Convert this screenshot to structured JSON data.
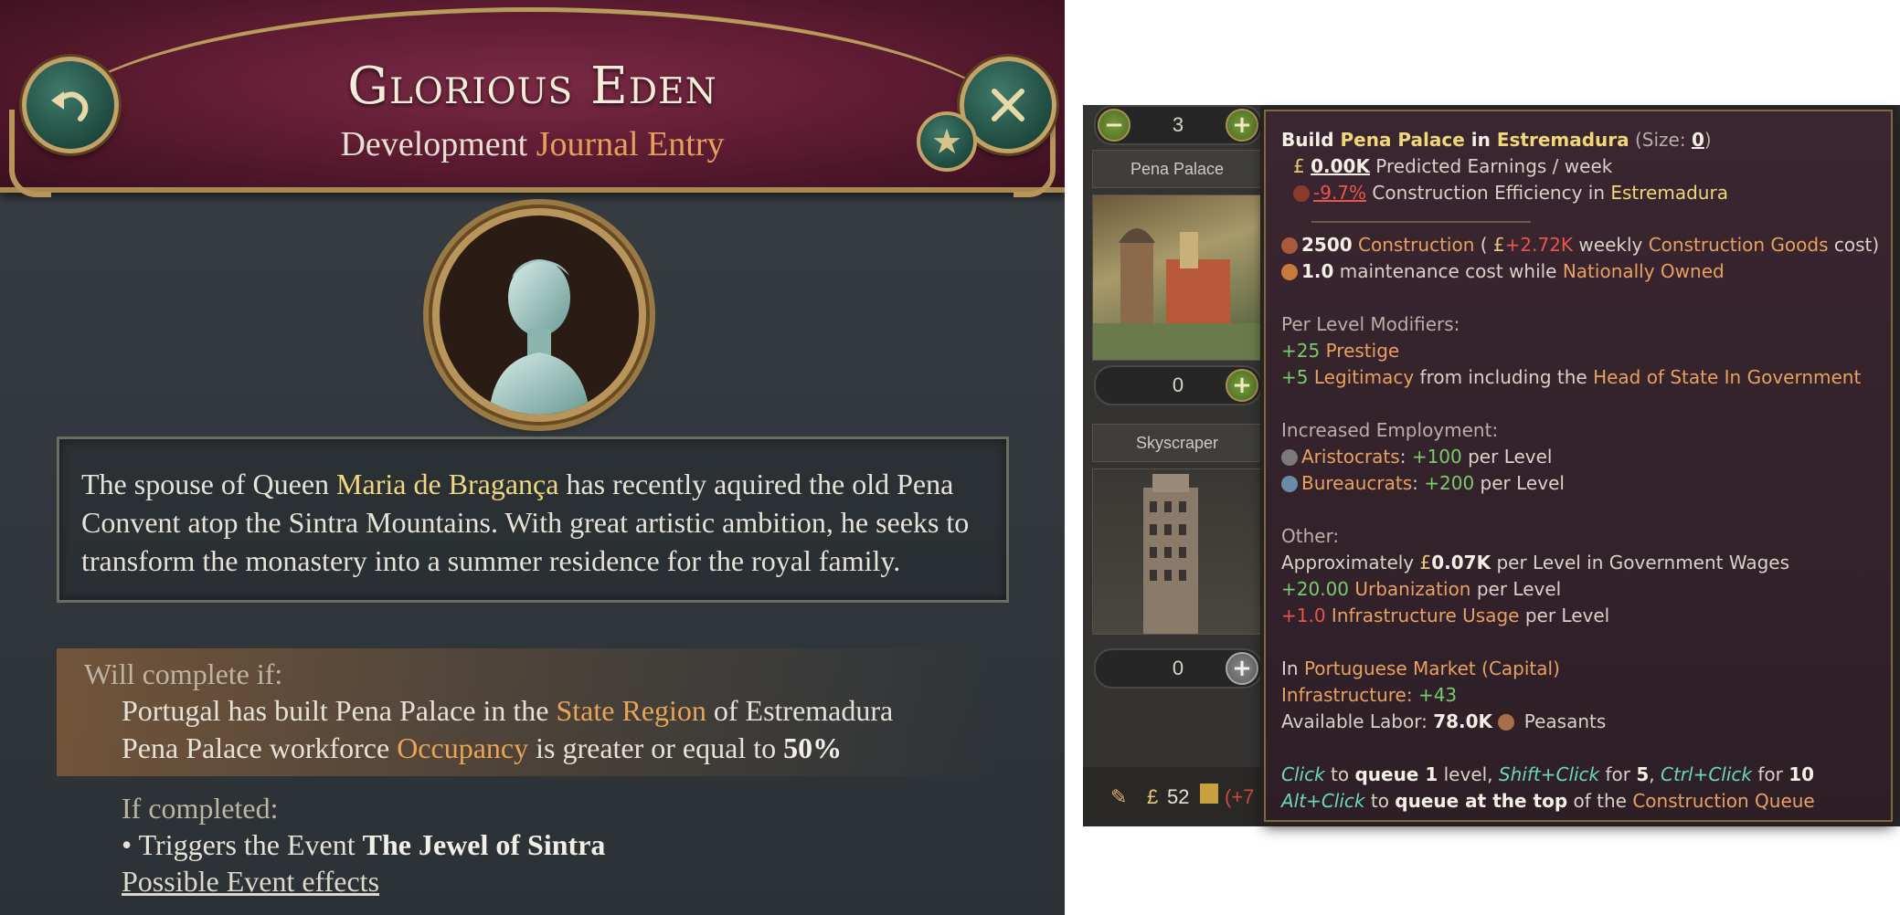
{
  "journal": {
    "title": "Glorious Eden",
    "subtitle_prefix": "Development",
    "subtitle_accent": "Journal Entry",
    "description": {
      "part1": "The spouse of Queen ",
      "name": "Maria de Bragança",
      "part2": " has recently aquired the old Pena",
      "line2": "Convent atop the Sintra Mountains. With great artistic ambition, he seeks to",
      "line3": "transform the monastery into a summer residence for the royal family."
    },
    "complete_if_label": "Will complete if:",
    "condition1": {
      "pre": "Portugal has built Pena Palace in the ",
      "accent": "State Region",
      "post": " of Estremadura"
    },
    "condition2": {
      "pre": "Pena Palace workforce ",
      "accent": "Occupancy",
      "mid": " is greater or equal to ",
      "value": "50%"
    },
    "if_completed_label": "If completed:",
    "trigger": {
      "pre": "• Triggers the Event ",
      "event": "The Jewel of Sintra"
    },
    "effects_link": "Possible Event effects",
    "icons": {
      "back": "back-arrow-icon",
      "close": "close-icon",
      "favorite": "star-icon",
      "portrait": "bust-statue-icon"
    }
  },
  "construction": {
    "stepper1_value": "3",
    "building1": "Pena Palace",
    "stepper2_value": "0",
    "building2": "Skyscraper",
    "stepper3_value": "0",
    "bottom_money": "52",
    "bottom_change": "(+7"
  },
  "tooltip": {
    "title_pre": "Build ",
    "title_building": "Pena Palace",
    "title_mid": " in ",
    "title_region": "Estremadura",
    "title_size_label": " (Size: ",
    "title_size": "0",
    "title_size_end": ")",
    "earnings_value": "0.00K",
    "earnings_label": " Predicted Earnings / week",
    "efficiency_value": "-9.7%",
    "efficiency_label": " Construction Efficiency in ",
    "efficiency_region": "Estremadura",
    "construction_value": "2500",
    "construction_label": " Construction",
    "construction_paren_open": " ( ",
    "construction_cost": "+2.72K",
    "construction_weekly": " weekly ",
    "construction_goods": "Construction Goods",
    "construction_cost_end": " cost)",
    "maintenance_value": "1.0",
    "maintenance_label": " maintenance cost while ",
    "maintenance_status": "Nationally Owned",
    "per_level_label": "Per Level Modifiers:",
    "prestige_value": "+25",
    "prestige_label": " Prestige",
    "legit_value": "+5",
    "legit_label": " Legitimacy",
    "legit_mid": " from including the ",
    "legit_source": "Head of State In Government",
    "employment_label": "Increased Employment:",
    "aristocrats_label": "Aristocrats",
    "aristocrats_value": "+100",
    "bureaucrats_label": "Bureaucrats",
    "bureaucrats_value": "+200",
    "per_level": " per Level",
    "other_label": "Other:",
    "wages_pre": "Approximately ",
    "wages_value": "0.07K",
    "wages_post": " per Level in Government Wages",
    "urban_value": "+20.00",
    "urban_label": " Urbanization",
    "infra_value": "+1.0",
    "infra_label": " Infrastructure Usage",
    "market_pre": "In ",
    "market_name": "Portuguese Market",
    "market_capital": "(Capital)",
    "infrastructure_label": "Infrastructure: ",
    "infrastructure_value": "+43",
    "labor_label": "Available Labor: ",
    "labor_value": "78.0K",
    "labor_type": " Peasants",
    "click": "Click",
    "to": " to ",
    "queue1": "queue 1",
    "level_comma": " level, ",
    "shift_click": "Shift+Click",
    "for": " for ",
    "five": "5",
    "comma": ", ",
    "ctrl_click": "Ctrl+Click",
    "ten": "10",
    "alt_click": "Alt+Click",
    "queue_top": "queue at the top",
    "of_the": " of the ",
    "queue_name": "Construction Queue"
  }
}
